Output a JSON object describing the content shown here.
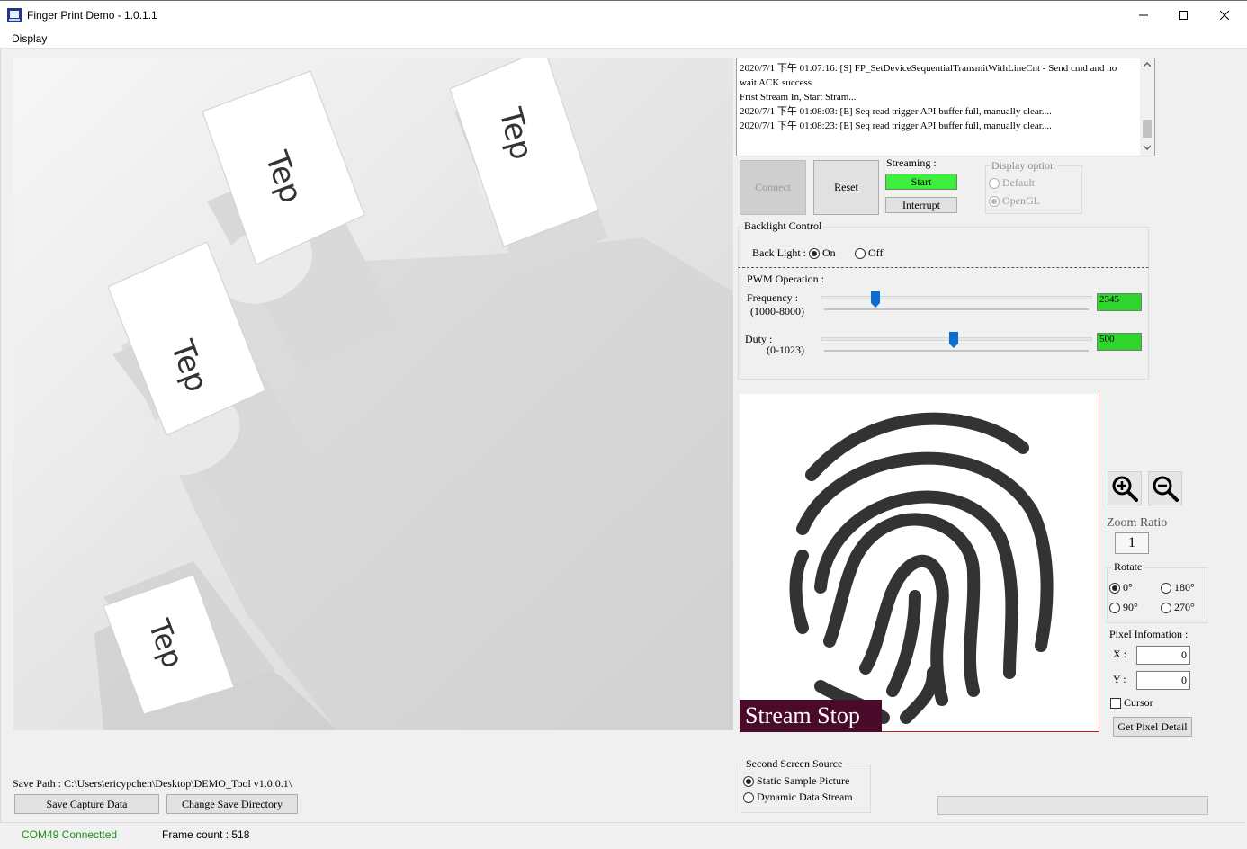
{
  "window": {
    "title": "Finger Print Demo - 1.0.1.1",
    "menu": [
      "Display"
    ]
  },
  "log": {
    "lines": [
      "2020/7/1 下午 01:07:16: [S] FP_SetDeviceSequentialTransmitWithLineCnt - Send cmd and no",
      "wait ACK success",
      "Frist Stream In, Start Stram...",
      "2020/7/1 下午 01:08:03: [E] Seq read trigger API buffer full, manually clear....",
      "2020/7/1 下午 01:08:23: [E] Seq read trigger API buffer full, manually clear...."
    ]
  },
  "controls": {
    "connect": "Connect",
    "reset": "Reset",
    "streaming_label": "Streaming :",
    "start": "Start",
    "interrupt": "Interrupt",
    "display_option": {
      "label": "Display option",
      "options": [
        "Default",
        "OpenGL"
      ],
      "selected": "OpenGL"
    }
  },
  "backlight": {
    "group_label": "Backlight Control",
    "label": "Back Light :",
    "on": "On",
    "off": "Off",
    "selected": "On"
  },
  "pwm": {
    "label": "PWM Operation :",
    "frequency_label": "Frequency :",
    "frequency_range": "(1000-8000)",
    "frequency_value": "2345",
    "frequency_min": 1000,
    "frequency_max": 8000,
    "duty_label": "Duty :",
    "duty_range": "(0-1023)",
    "duty_value": "500",
    "duty_min": 0,
    "duty_max": 1023
  },
  "preview": {
    "overlay": "Stream Stop"
  },
  "zoom": {
    "label": "Zoom Ratio",
    "value": "1",
    "rotate_label": "Rotate",
    "rotate_options": [
      "0°",
      "180°",
      "90°",
      "270°"
    ],
    "rotate_selected": "0°"
  },
  "pixel": {
    "label": "Pixel Infomation :",
    "x_label": "X :",
    "x_value": "0",
    "y_label": "Y :",
    "y_value": "0",
    "cursor_label": "Cursor",
    "get_detail": "Get Pixel Detail"
  },
  "second_screen": {
    "label": "Second Screen Source",
    "options": [
      "Static Sample Picture",
      "Dynamic Data Stream"
    ],
    "selected": "Static Sample Picture"
  },
  "save": {
    "path_label": "Save Path : C:\\Users\\ericypchen\\Desktop\\DEMO_Tool v1.0.0.1\\",
    "save_capture": "Save Capture Data",
    "change_dir": "Change Save Directory"
  },
  "status": {
    "connection": "COM49 Connectted",
    "frame_count": "Frame count : 518"
  },
  "colors": {
    "connected_text": "#1e8f1e",
    "green_field": "#2dd52d",
    "overlay_bg": "#4a0a2a",
    "slider_thumb": "#0a6ed1"
  }
}
